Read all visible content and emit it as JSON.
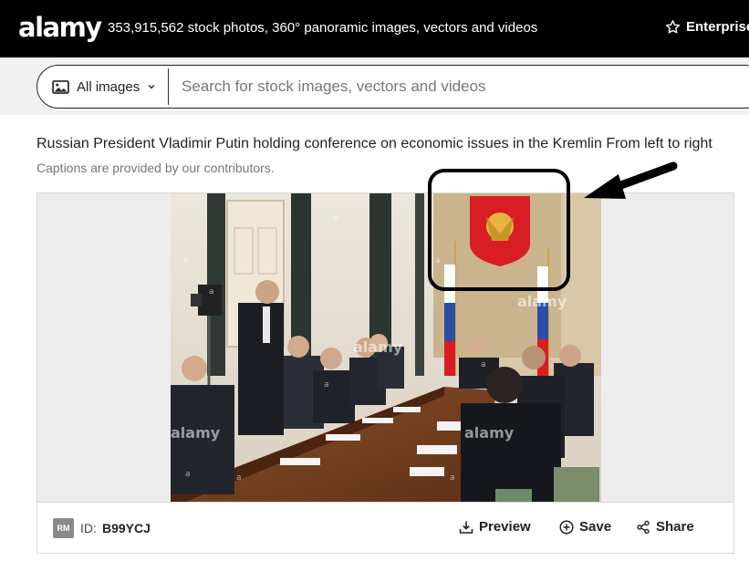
{
  "header": {
    "logo": "alamy",
    "tagline": "353,915,562 stock photos, 360° panoramic images, vectors and videos",
    "enterprise_label": "Enterprise",
    "enterprise_icon": "star-icon"
  },
  "search": {
    "filter_label": "All images",
    "filter_icon": "image-icon",
    "placeholder": "Search for stock images, vectors and videos"
  },
  "caption": {
    "title": "Russian President Vladimir Putin holding conference on economic issues in the Kremlin From left to right",
    "note": "Captions are provided by our contributors."
  },
  "image": {
    "alt": "Russian President Vladimir Putin holding conference on economic issues in the Kremlin",
    "watermark": "alamy"
  },
  "infobar": {
    "badge": "RM",
    "id_label": "ID:",
    "id_value": "B99YCJ",
    "preview_label": "Preview",
    "save_label": "Save",
    "share_label": "Share"
  },
  "colors": {
    "header_bg": "#000000",
    "search_strip_bg": "#f1f1f1",
    "annotation": "#000000"
  }
}
